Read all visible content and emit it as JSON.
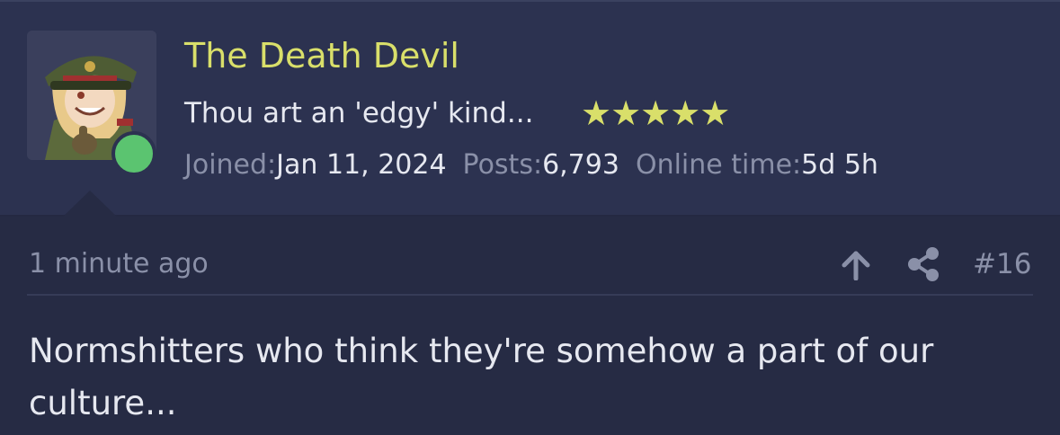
{
  "user": {
    "name": "The Death Devil",
    "title": "Thou art an 'edgy' kind...",
    "stars": "★★★★★",
    "online": true
  },
  "stats": {
    "joined_label": "Joined:",
    "joined_value": "Jan 11, 2024",
    "posts_label": "Posts:",
    "posts_value": "6,793",
    "online_label": "Online time:",
    "online_value": "5d 5h"
  },
  "post": {
    "time_ago": "1 minute ago",
    "number": "#16",
    "body": "Normshitters who think they're somehow a part of our culture..."
  },
  "colors": {
    "background": "#262b44",
    "header": "#2c3250",
    "username": "#d9df6a",
    "online_status": "#5bc470",
    "muted_text": "#8a90a8"
  },
  "icons": {
    "up": "arrow-up-icon",
    "share": "share-icon"
  }
}
